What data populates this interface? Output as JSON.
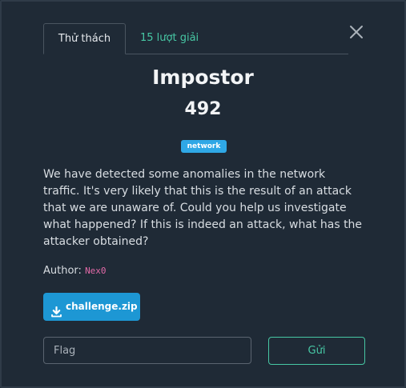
{
  "tabs": {
    "challenge_label": "Thử thách",
    "solves_label": "15 lượt giải"
  },
  "challenge": {
    "name": "Impostor",
    "points": "492",
    "category": "network",
    "description": "We have detected some anomalies in the network traffic. It's very likely that this is the result of an attack that we are unaware of. Could you help us investigate what happened? If this is indeed an attack, what has the attacker obtained?",
    "author_label": "Author:",
    "author_name": "Nex0"
  },
  "download": {
    "label": "challenge.zip",
    "icon": "download-icon"
  },
  "flag": {
    "placeholder": "Flag",
    "value": ""
  },
  "submit": {
    "label": "Gửi"
  },
  "colors": {
    "accent_green": "#47c7a4",
    "badge_blue": "#2fa8e6",
    "button_blue": "#1d97d4",
    "author_pink": "#e36aa8",
    "background": "#1f2a36"
  }
}
